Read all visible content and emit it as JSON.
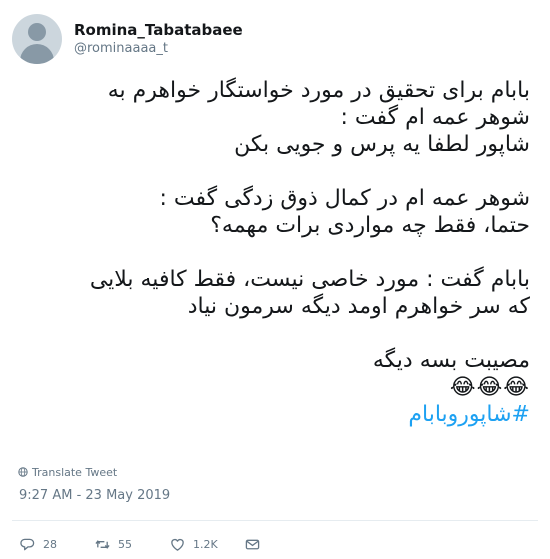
{
  "user": {
    "display_name": "Romina_Tabatabaee",
    "handle": "@rominaaaa_t"
  },
  "tweet": {
    "paragraph1": [
      "بابام برای تحقیق در مورد خواستگار خواهرم به",
      "شوهر عمه ام گفت :",
      "شاپور لطفا  یه پرس و جویی بکن"
    ],
    "paragraph2": [
      "شوهر عمه ام در کمال ذوق زدگی گفت :",
      "حتما، فقط چه مواردی برات مهمه؟"
    ],
    "paragraph3": [
      "بابام گفت : مورد خاصی نیست، فقط کافیه بلایی",
      "که سر خواهرم اومد دیگه سرمون نیاد"
    ],
    "closing": "مصیبت بسه دیگه",
    "emojis": [
      "😂",
      "😂",
      "😂"
    ],
    "hashtag": "#شاپوروبابام"
  },
  "translate_label": "Translate Tweet",
  "timestamp": "9:27 AM - 23 May 2019",
  "actions": {
    "replies": "28",
    "retweets": "55",
    "likes": "1.2K"
  },
  "icons": {
    "reply": "reply-icon",
    "retweet": "retweet-icon",
    "like": "heart-icon",
    "dm": "envelope-icon",
    "translate": "globe-icon"
  },
  "colors": {
    "link": "#1da1f2",
    "muted": "#657786",
    "text": "#14171a"
  }
}
